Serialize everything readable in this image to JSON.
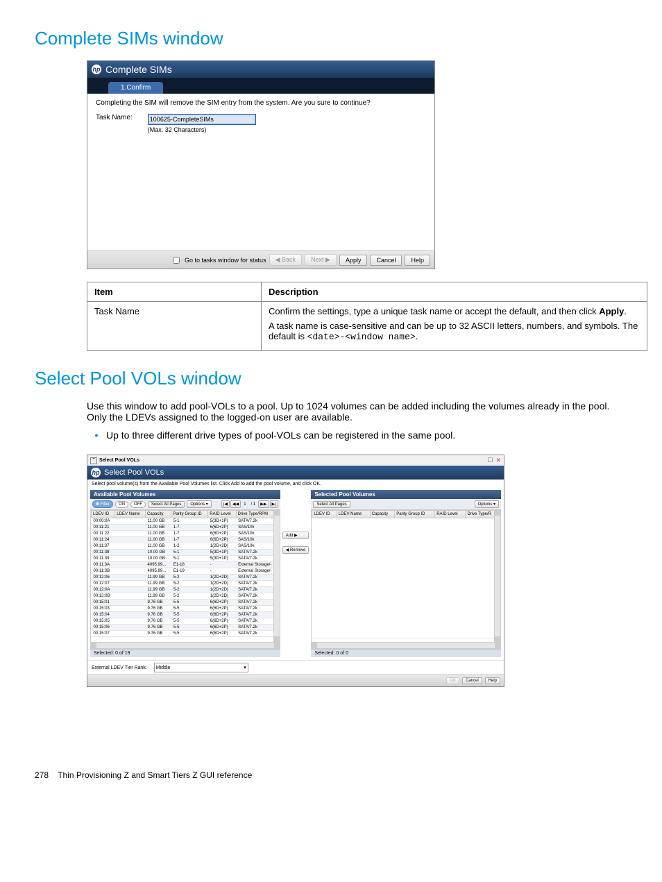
{
  "h1_sims": "Complete SIMs window",
  "sims": {
    "title": "Complete SIMs",
    "tab": "1.Confirm",
    "warn": "Completing the SIM will remove the SIM entry from the system. Are you sure to continue?",
    "lbl_taskname": "Task Name:",
    "task_value": "100625-CompleteSIMs",
    "hint": "(Max. 32 Characters)",
    "chk_lbl": "Go to tasks window for status",
    "btn_back": "◀ Back",
    "btn_next": "Next ▶",
    "btn_apply": "Apply",
    "btn_cancel": "Cancel",
    "btn_help": "Help"
  },
  "desc": {
    "h_item": "Item",
    "h_desc": "Description",
    "item1": "Task Name",
    "d1a_pre": "Confirm the settings, type a unique task name or accept the default, and then click ",
    "d1a_b": "Apply",
    "d1a_post": ".",
    "d1b_pre": "A task name is case-sensitive and can be up to 32 ASCII letters, numbers, and symbols. The default is ",
    "d1b_code": "<date>-<window name>",
    "d1b_post": "."
  },
  "h1_pool": "Select Pool VOLs window",
  "pool_intro": "Use this window to add pool-VOLs to a pool. Up to 1024 volumes can be added including the volumes already in the pool. Only the LDEVs assigned to the logged-on user are available.",
  "pool_bullet": "Up to three different drive types of pool-VOLs can be registered in the same pool.",
  "pool": {
    "top_title": "Select Pool VOLs",
    "title": "Select Pool VOLs",
    "instr": "Select pool volume(s) from the Available Pool Volumes list. Click Add to add the pool volume, and click OK.",
    "left_hd": "Available Pool Volumes",
    "right_hd": "Selected Pool Volumes",
    "filter": "✽ Filter",
    "on": "ON",
    "off": "OFF",
    "select_all": "Select All Pages",
    "options": "Options ▾",
    "pager_first": "|◀",
    "pager_prev": "◀◀",
    "pager_page": "1",
    "pager_of": "/ 1",
    "pager_next": "▶▶",
    "pager_last": "▶|",
    "cols": [
      "LDEV ID",
      "LDEV Name",
      "Capacity",
      "Parity Group ID",
      "RAID Level",
      "Drive Type/RPM"
    ],
    "cols_r": [
      "LDEV ID",
      "LDEV Name",
      "Capacity",
      "Parity Group ID",
      "RAID Level",
      "Drive Type/R"
    ],
    "rows": [
      [
        "00:00:0A",
        "",
        "11.00 GB",
        "5-1",
        "5(3D+1P)",
        "SATA/7.2k"
      ],
      [
        "00:11:21",
        "",
        "11.00 GB",
        "1-7",
        "6(6D+2P)",
        "SAS/10k"
      ],
      [
        "00:11:22",
        "",
        "11.00 GB",
        "1-7",
        "6(6D+2P)",
        "SAS/10k"
      ],
      [
        "00:11:24",
        "",
        "11.00 GB",
        "1-7",
        "6(6D+2P)",
        "SAS/10k"
      ],
      [
        "00:11:37",
        "",
        "11.00 GB",
        "1-2",
        "1(2D+2D)",
        "SAS/10k"
      ],
      [
        "00:11:38",
        "",
        "10.00 GB",
        "5-1",
        "5(3D+1P)",
        "SATA/7.2k"
      ],
      [
        "00:11:39",
        "",
        "10.00 GB",
        "5-1",
        "5(3D+1P)",
        "SATA/7.2k"
      ],
      [
        "00:11:3A",
        "",
        "4095.99...",
        "E1-18",
        "-",
        "External Storage/-"
      ],
      [
        "00:11:3B",
        "",
        "4095.99...",
        "E1-19",
        "-",
        "External Storage/-"
      ],
      [
        "00:12:06",
        "",
        "11.99 GB",
        "5-2",
        "1(2D+2D)",
        "SATA/7.2k"
      ],
      [
        "00:12:07",
        "",
        "11.99 GB",
        "5-2",
        "1(2D+2D)",
        "SATA/7.2k"
      ],
      [
        "00:12:0A",
        "",
        "11.99 GB",
        "5-2",
        "1(2D+2D)",
        "SATA/7.2k"
      ],
      [
        "00:12:0B",
        "",
        "11.99 GB",
        "5-2",
        "1(2D+2D)",
        "SATA/7.2k"
      ],
      [
        "00:15:01",
        "",
        "9.76 GB",
        "5-5",
        "6(6D+2P)",
        "SATA/7.2k"
      ],
      [
        "00:15:03",
        "",
        "9.76 GB",
        "5-5",
        "6(6D+2P)",
        "SATA/7.2k"
      ],
      [
        "00:15:04",
        "",
        "9.76 GB",
        "5-5",
        "6(6D+2P)",
        "SATA/7.2k"
      ],
      [
        "00:15:05",
        "",
        "9.76 GB",
        "5-5",
        "6(6D+2P)",
        "SATA/7.2k"
      ],
      [
        "00:15:06",
        "",
        "9.76 GB",
        "5-5",
        "6(6D+2P)",
        "SATA/7.2k"
      ],
      [
        "00:15:07",
        "",
        "9.76 GB",
        "5-5",
        "6(6D+2P)",
        "SATA/7.2k"
      ]
    ],
    "sel_left": "Selected:  0  of  19",
    "sel_right": "Selected:  0  of 0",
    "btn_add": "Add ▶",
    "btn_remove": "◀ Remove",
    "rank_lbl": "External LDEV Tier Rank:",
    "rank_val": "Middle",
    "ok": "OK",
    "cancel": "Cancel",
    "help": "Help",
    "max": "☐",
    "close": "✕"
  },
  "foot_pg": "278",
  "foot_txt": "Thin Provisioning Z and Smart Tiers Z GUI reference"
}
